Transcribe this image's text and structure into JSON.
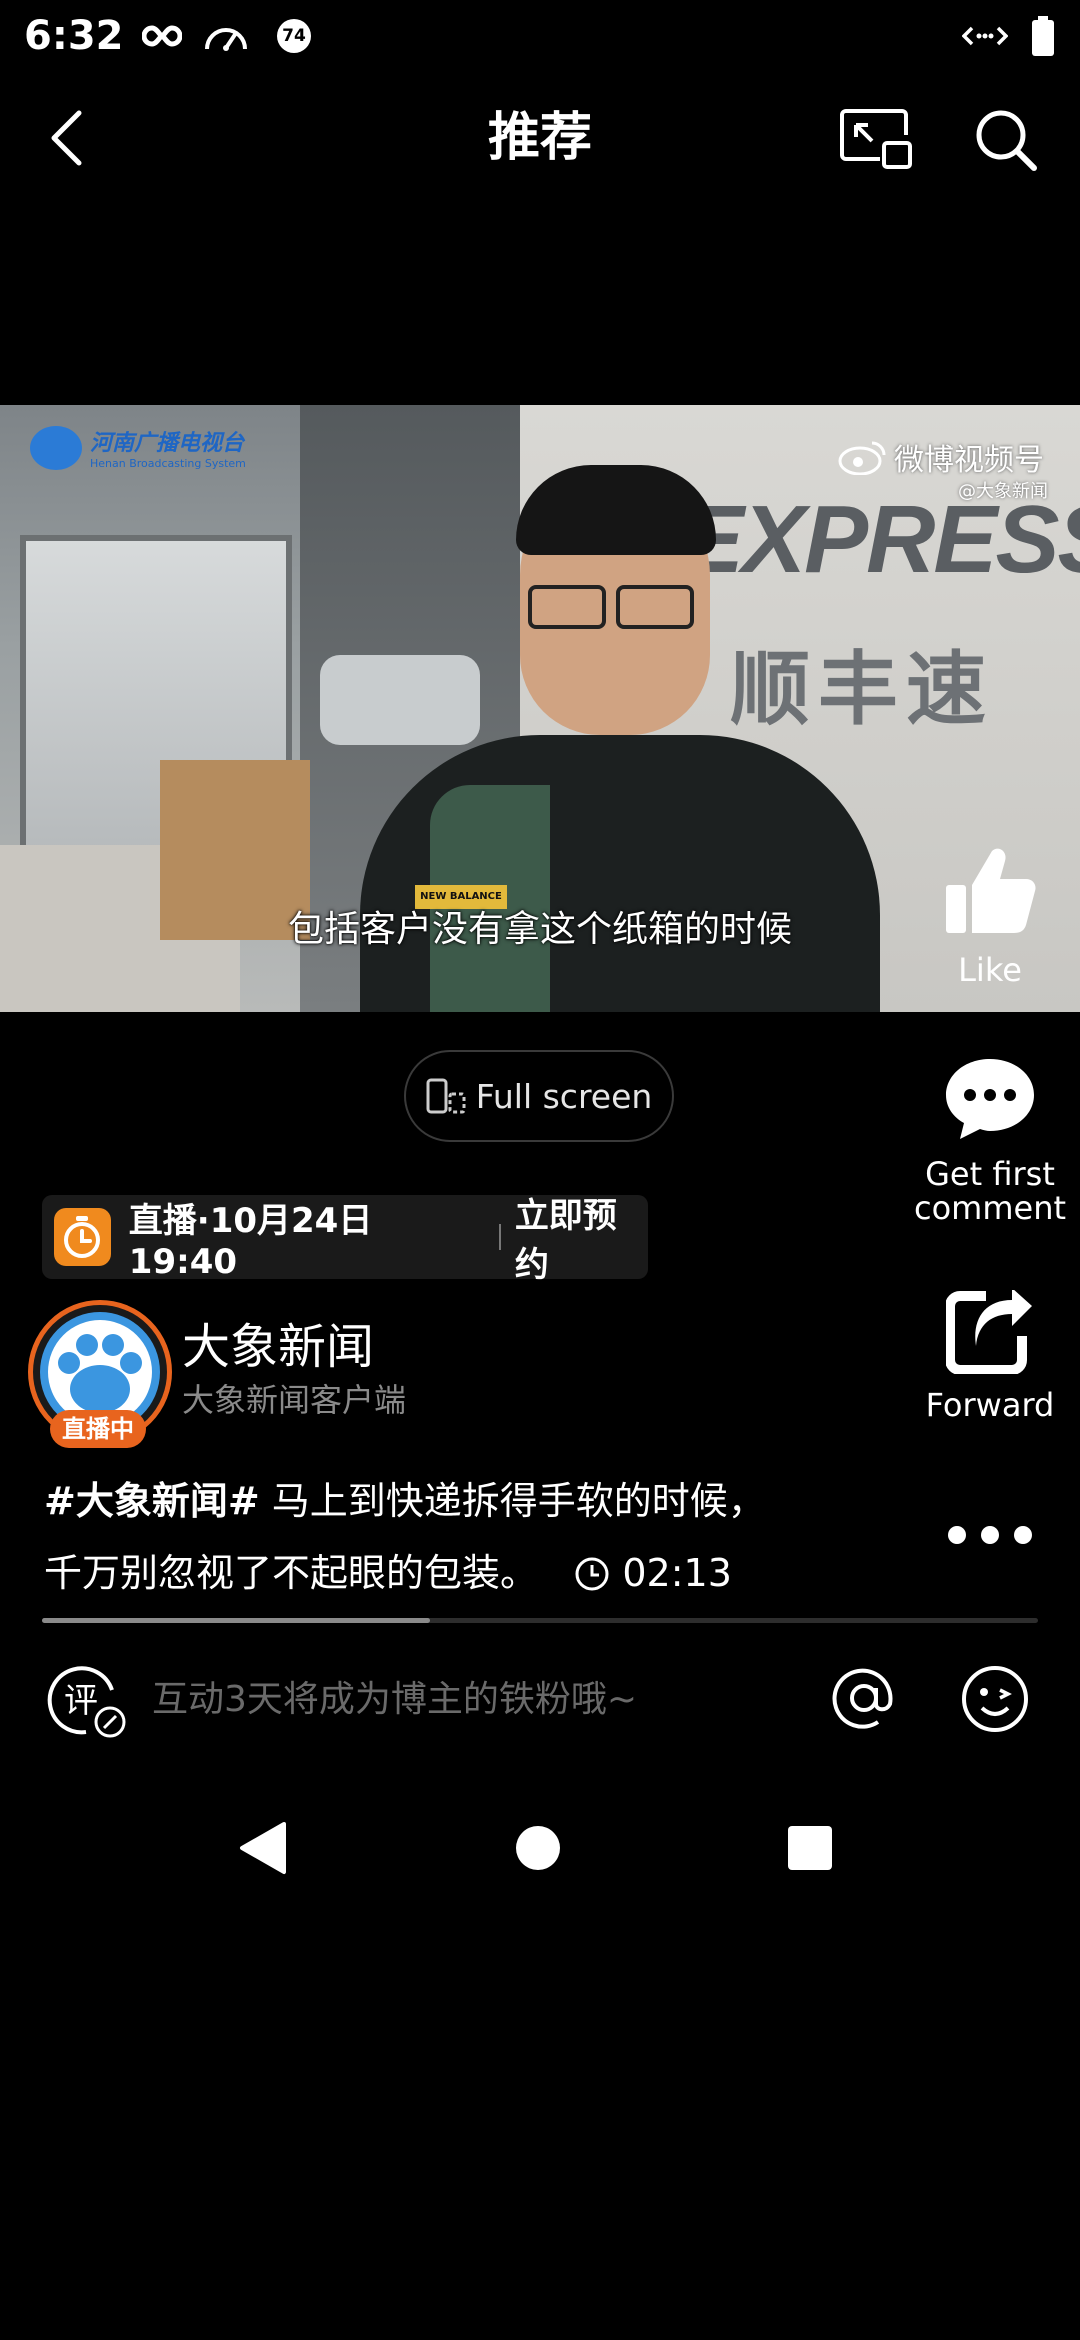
{
  "status_bar": {
    "time": "6:32",
    "icons_left": [
      "infinity-icon",
      "speedometer-icon",
      "notification-badge-icon"
    ],
    "notification_count": "74",
    "icons_right": [
      "data-arrows-icon",
      "battery-icon"
    ]
  },
  "top_nav": {
    "title": "推荐",
    "back_icon": "back-arrow-icon",
    "pip_icon": "picture-in-picture-icon",
    "search_icon": "search-icon"
  },
  "video": {
    "subtitle": "包括客户没有拿这个纸箱的时候",
    "watermark_left": "河南广播电视台",
    "watermark_left_sub": "Henan Broadcasting System",
    "watermark_right": "微博视频号",
    "watermark_right_sub": "@大象新闻",
    "wall_sign": "EXPRESS",
    "wall_sign_cn": "顺丰速运",
    "jacket_label": "NEW BALANCE"
  },
  "actions": {
    "like_label": "Like",
    "comment_label_line1": "Get first",
    "comment_label_line2": "comment",
    "forward_label": "Forward",
    "more_icon": "more-dots-icon"
  },
  "fullscreen": {
    "label": "Full screen"
  },
  "live_banner": {
    "text": "直播·10月24日 19:40",
    "reserve": "立即预约"
  },
  "account": {
    "name": "大象新闻",
    "subtitle": "大象新闻客户端",
    "live_badge": "直播中"
  },
  "caption": {
    "hashtag": "#大象新闻#",
    "text_line1": " 马上到快递拆得手软的时候，",
    "text_line2": "千万别忽视了不起眼的包装。",
    "duration": "02:13"
  },
  "progress": {
    "fraction": 0.39
  },
  "comment_bar": {
    "placeholder": "互动3天将成为博主的铁粉哦~",
    "comment_icon": "comment-edit-icon",
    "at_icon": "at-icon",
    "emoji_icon": "emoji-icon"
  },
  "colors": {
    "accent_orange": "#f08a1e",
    "live_orange": "#e8641e",
    "background": "#000000"
  }
}
